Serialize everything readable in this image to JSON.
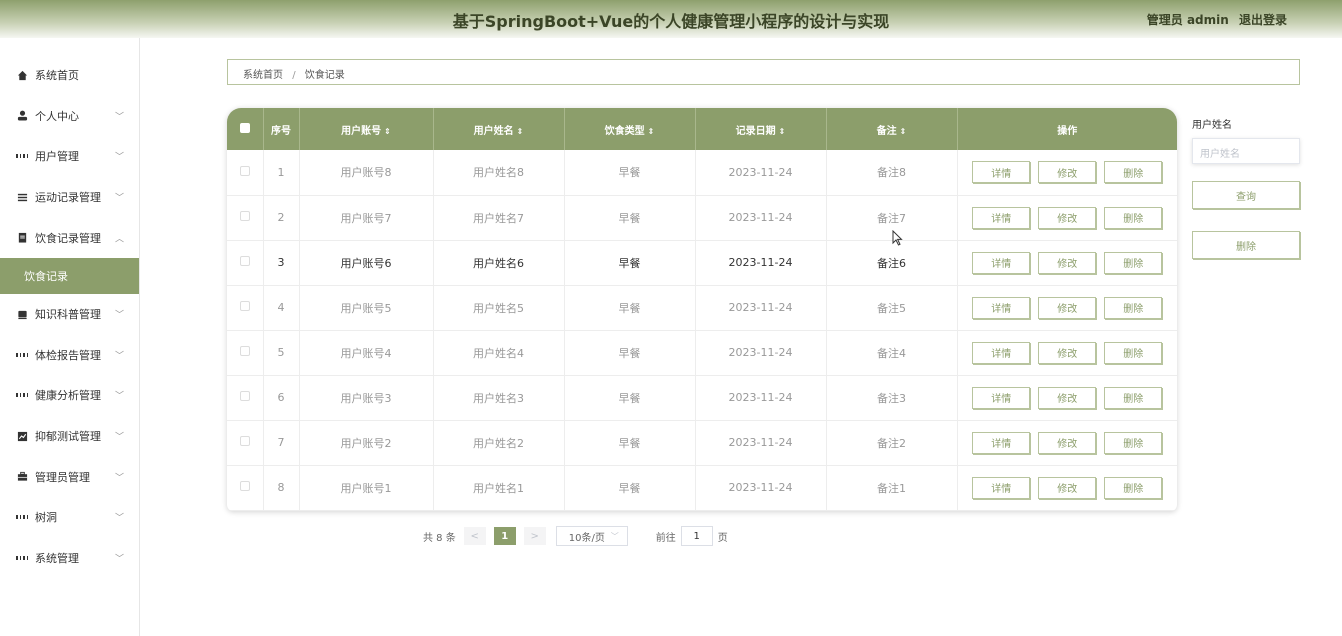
{
  "header": {
    "title": "基于SpringBoot+Vue的个人健康管理小程序的设计与实现",
    "admin_label": "管理员 admin",
    "logout_label": "退出登录"
  },
  "sidebar": {
    "items": [
      {
        "label": "系统首页",
        "icon": "home-icon",
        "has_arrow": false
      },
      {
        "label": "个人中心",
        "icon": "user-icon",
        "has_arrow": true
      },
      {
        "label": "用户管理",
        "icon": "grid-icon",
        "has_arrow": true
      },
      {
        "label": "运动记录管理",
        "icon": "list-icon",
        "has_arrow": true
      },
      {
        "label": "饮食记录管理",
        "icon": "clipboard-icon",
        "has_arrow": true,
        "expanded": true
      },
      {
        "label": "饮食记录",
        "sub": true,
        "active": true
      },
      {
        "label": "知识科普管理",
        "icon": "book-icon",
        "has_arrow": true
      },
      {
        "label": "体检报告管理",
        "icon": "grid-icon",
        "has_arrow": true
      },
      {
        "label": "健康分析管理",
        "icon": "grid-icon",
        "has_arrow": true
      },
      {
        "label": "抑郁测试管理",
        "icon": "chart-icon",
        "has_arrow": true
      },
      {
        "label": "管理员管理",
        "icon": "briefcase-icon",
        "has_arrow": true
      },
      {
        "label": "树洞",
        "icon": "grid-icon",
        "has_arrow": true
      },
      {
        "label": "系统管理",
        "icon": "grid-icon",
        "has_arrow": true
      }
    ]
  },
  "breadcrumb": {
    "home": "系统首页",
    "separator": "/",
    "current": "饮食记录"
  },
  "table": {
    "columns": [
      "序号",
      "用户账号",
      "用户姓名",
      "饮食类型",
      "记录日期",
      "备注",
      "操作"
    ],
    "rows": [
      {
        "index": "1",
        "account": "用户账号8",
        "name": "用户姓名8",
        "type": "早餐",
        "date": "2023-11-24",
        "note": "备注8"
      },
      {
        "index": "2",
        "account": "用户账号7",
        "name": "用户姓名7",
        "type": "早餐",
        "date": "2023-11-24",
        "note": "备注7"
      },
      {
        "index": "3",
        "account": "用户账号6",
        "name": "用户姓名6",
        "type": "早餐",
        "date": "2023-11-24",
        "note": "备注6"
      },
      {
        "index": "4",
        "account": "用户账号5",
        "name": "用户姓名5",
        "type": "早餐",
        "date": "2023-11-24",
        "note": "备注5"
      },
      {
        "index": "5",
        "account": "用户账号4",
        "name": "用户姓名4",
        "type": "早餐",
        "date": "2023-11-24",
        "note": "备注4"
      },
      {
        "index": "6",
        "account": "用户账号3",
        "name": "用户姓名3",
        "type": "早餐",
        "date": "2023-11-24",
        "note": "备注3"
      },
      {
        "index": "7",
        "account": "用户账号2",
        "name": "用户姓名2",
        "type": "早餐",
        "date": "2023-11-24",
        "note": "备注2"
      },
      {
        "index": "8",
        "account": "用户账号1",
        "name": "用户姓名1",
        "type": "早餐",
        "date": "2023-11-24",
        "note": "备注1"
      }
    ],
    "actions": {
      "detail": "详情",
      "edit": "修改",
      "delete": "删除"
    }
  },
  "pagination": {
    "total": "共 8 条",
    "prev": "<",
    "current_page": "1",
    "next": ">",
    "page_size": "10条/页",
    "goto_label": "前往",
    "goto_value": "1",
    "goto_unit": "页"
  },
  "search": {
    "label": "用户姓名",
    "placeholder": "用户姓名",
    "query_button": "查询",
    "delete_button": "删除"
  },
  "colors": {
    "accent": "#8c9e6b",
    "accent_border": "#b8c49e"
  }
}
